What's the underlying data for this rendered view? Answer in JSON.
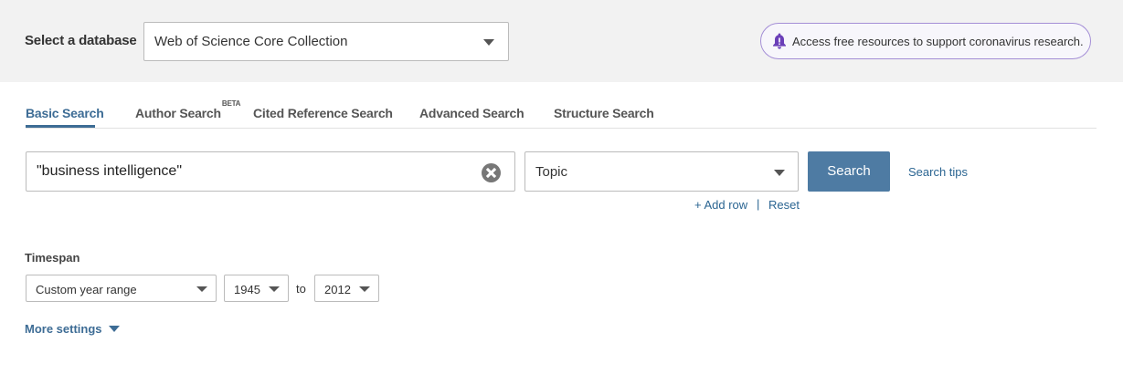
{
  "database": {
    "label": "Select a database",
    "selected": "Web of Science Core Collection"
  },
  "banner": {
    "icon": "bell-icon",
    "text": "Access free resources to support coronavirus research."
  },
  "tabs": [
    {
      "label": "Basic Search",
      "active": true
    },
    {
      "label": "Author Search",
      "badge": "BETA"
    },
    {
      "label": "Cited Reference Search"
    },
    {
      "label": "Advanced Search"
    },
    {
      "label": "Structure Search"
    }
  ],
  "search": {
    "query": "\"business intelligence\"",
    "field": "Topic",
    "button_label": "Search",
    "tips_label": "Search tips",
    "add_row_label": "+ Add row",
    "separator": "|",
    "reset_label": "Reset"
  },
  "timespan": {
    "label": "Timespan",
    "range_type": "Custom year range",
    "from_year": "1945",
    "to_label": "to",
    "to_year": "2012"
  },
  "more_settings_label": "More settings",
  "colors": {
    "accent": "#3d6c95",
    "search_button": "#4e7ba3",
    "banner_border": "#a48ed6",
    "bell": "#6b3fb8"
  }
}
